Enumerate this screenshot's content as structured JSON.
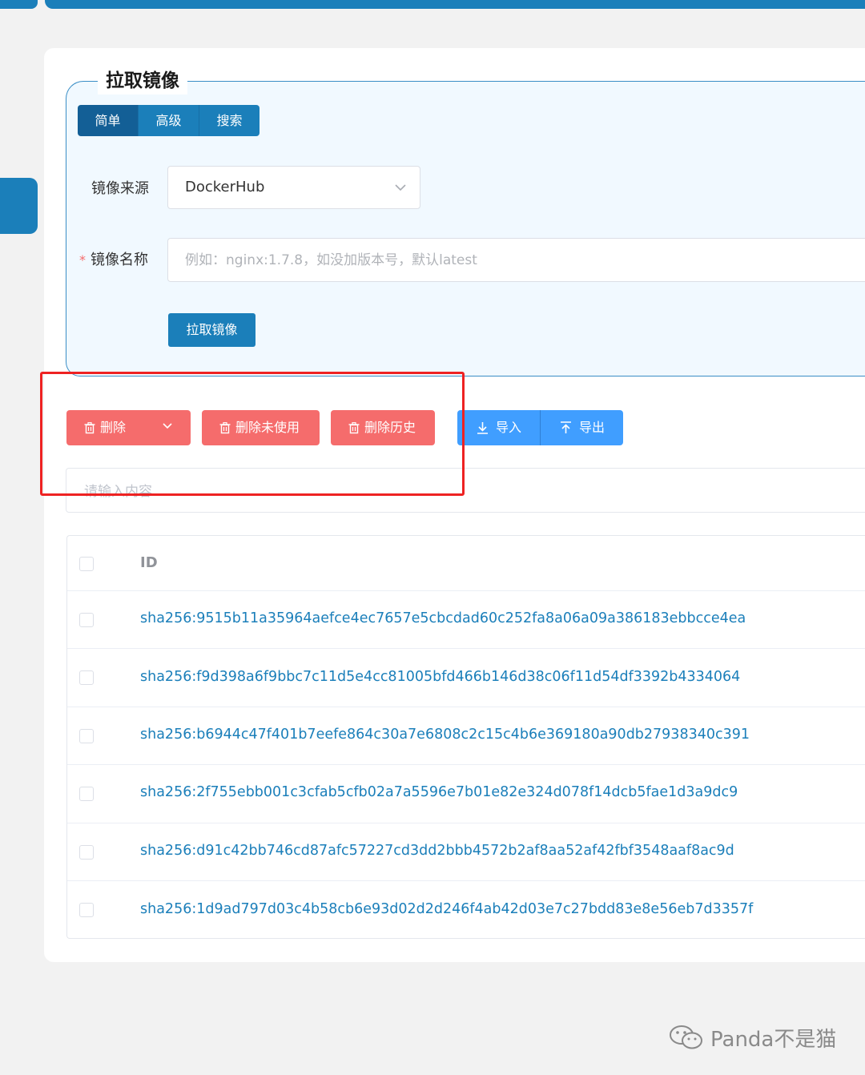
{
  "panel": {
    "title": "拉取镜像",
    "tabs": [
      {
        "label": "简单",
        "active": true
      },
      {
        "label": "高级",
        "active": false
      },
      {
        "label": "搜索",
        "active": false
      }
    ],
    "source_label": "镜像来源",
    "source_value": "DockerHub",
    "required_mark": "*",
    "name_label": "镜像名称",
    "name_placeholder": "例如：nginx:1.7.8，如没加版本号，默认latest",
    "pull_button": "拉取镜像"
  },
  "toolbar": {
    "delete_label": "删除",
    "delete_unused_label": "删除未使用",
    "delete_history_label": "删除历史",
    "import_label": "导入",
    "export_label": "导出"
  },
  "search": {
    "placeholder": "请输入内容"
  },
  "table": {
    "header_id": "ID",
    "rows": [
      "sha256:9515b11a35964aefce4ec7657e5cbcdad60c252fa8a06a09a386183ebbcce4ea",
      "sha256:f9d398a6f9bbc7c11d5e4cc81005bfd466b146d38c06f11d54df3392b4334064",
      "sha256:b6944c47f401b7eefe864c30a7e6808c2c15c4b6e369180a90db27938340c391",
      "sha256:2f755ebb001c3cfab5cfb02a7a5596e7b01e82e324d078f14dcb5fae1d3a9dc9",
      "sha256:d91c42bb746cd87afc57227cd3dd2bbb4572b2af8aa52af42fbf3548aaf8ac9d",
      "sha256:1d9ad797d03c4b58cb6e93d02d2d246f4ab42d03e7c27bdd83e8e56eb7d3357f"
    ]
  },
  "watermark": {
    "text": "Panda不是猫",
    "icon": "wechat-icon"
  },
  "colors": {
    "primary": "#1b7fba",
    "danger": "#f56c6c",
    "info": "#409eff",
    "highlight_box": "#ee2222"
  }
}
